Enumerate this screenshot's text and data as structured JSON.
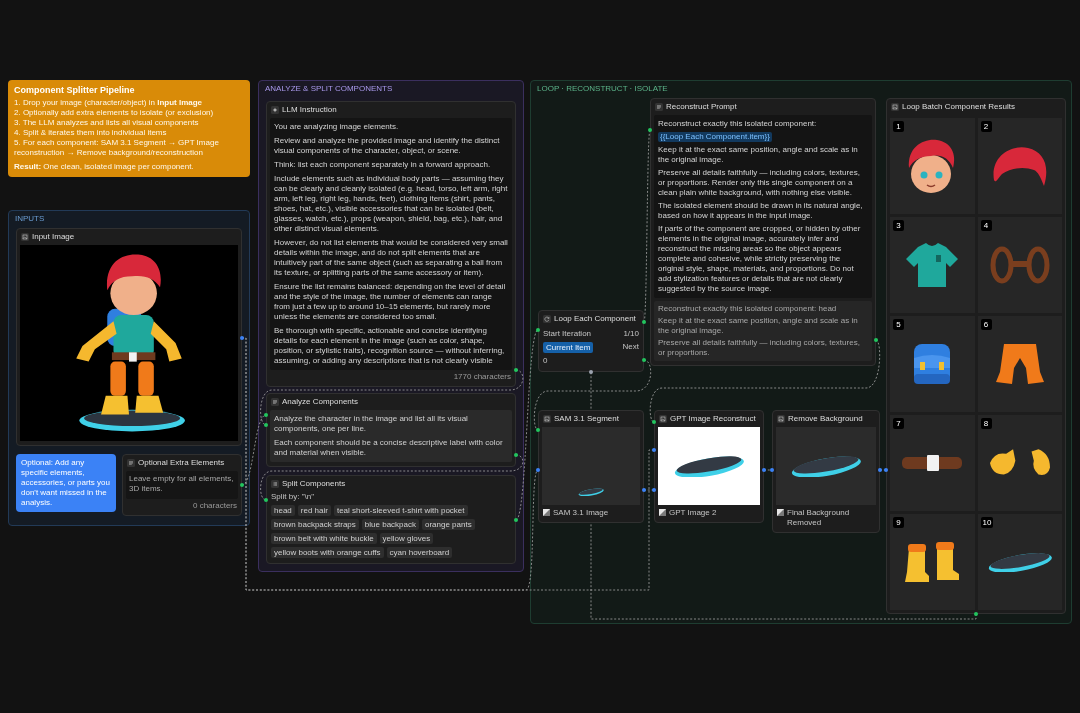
{
  "pipeline_note": {
    "title": "Component Splitter Pipeline",
    "steps": [
      "1. Drop your image (character/object) in **Input Image**",
      "2. Optionally add extra elements to isolate (or exclusion)",
      "3. The LLM analyzes and lists all visual components",
      "4. Split & iterates them into individual items",
      "5. For each component: SAM 3.1 Segment → GPT Image reconstruction → Remove background/reconstruction"
    ],
    "result": "**Result:** One clean, isolated image per component."
  },
  "inputs_group": {
    "title": "INPUTS",
    "input_image": {
      "title": "Input Image"
    },
    "hint": "Optional: Add any specific elements, accessories, or parts you don't want missed in the analysis.",
    "extra_elements": {
      "title": "Optional Extra Elements",
      "placeholder": "Leave empty for all elements, 3D items.",
      "counter": "0 characters"
    }
  },
  "analyze_group": {
    "title": "ANALYZE & SPLIT COMPONENTS",
    "llm_instruction": {
      "title": "LLM Instruction",
      "paragraphs": [
        "You are analyzing image elements.",
        "Review and analyze the provided image and identify the distinct visual components of the character, object, or scene.",
        "Think: list each component separately in a forward approach.",
        "Include elements such as individual body parts — assuming they can be clearly and cleanly isolated (e.g. head, torso, left arm, right arm, left leg, right leg, hands, feet), clothing items (shirt, pants, shoes, hat, etc.), visible accessories that can be isolated (belt, glasses, watch, etc.), props (weapon, shield, bag, etc.), hair, and other distinct visual elements.",
        "However, do not list elements that would be considered very small details within the image, and do not split elements that are intuitively part of the same object (such as separating a ball from its texture, or splitting parts of the same accessory or item).",
        "Ensure the list remains balanced: depending on the level of detail and the style of the image, the number of elements can range from just a few up to around 10–15 elements, but rarely more unless the elements are considered too small.",
        "Be thorough with specific, actionable and concise identifying details for each element in the image (such as color, shape, position, or stylistic traits), recognition source — without inferring, assuming, or adding any descriptions that is not clearly visible"
      ],
      "counter": "1770 characters"
    },
    "analyze_components": {
      "title": "Analyze Components",
      "paragraphs": [
        "Analyze the character in the image and list all its visual components, one per line.",
        "Each component should be a concise descriptive label with color and material when visible."
      ]
    },
    "split_components": {
      "title": "Split Components",
      "split_by": "Split by: \"\\n\"",
      "items": [
        "head",
        "red hair",
        "teal short-sleeved t-shirt with pocket",
        "brown backpack straps",
        "blue backpack",
        "orange pants",
        "brown belt with white buckle",
        "yellow gloves",
        "yellow boots with orange cuffs",
        "cyan hoverboard"
      ]
    }
  },
  "loop_group": {
    "title": "LOOP · RECONSTRUCT · ISOLATE",
    "reconstruct_prompt": {
      "title": "Reconstruct Prompt",
      "intro": "Reconstruct exactly this isolated component:",
      "variable": "{{Loop Each Component.item}}",
      "paragraphs": [
        "Keep it at the exact same position, angle and scale as in the original image.",
        "Preserve all details faithfully — including colors, textures, or proportions. Render only this single component on a clean plain white background, with nothing else visible.",
        "The isolated element should be drawn in its natural angle, based on how it appears in the input image.",
        "If parts of the component are cropped, or hidden by other elements in the original image, accurately infer and reconstruct the missing areas so the object appears complete and cohesive, while strictly preserving the original style, shape, materials, and proportions. Do not add stylization features or details that are not clearly suggested by the source image."
      ],
      "previews": [
        "Reconstruct exactly this isolated component: head",
        "Keep it at the exact same position, angle and scale as in the original image.",
        "Preserve all details faithfully — including colors, textures, or proportions."
      ]
    },
    "loop_each": {
      "title": "Loop Each Component",
      "start_label": "Start Iteration",
      "start_value": "1/10",
      "current": "Current Item",
      "next": "Next",
      "index": "0"
    },
    "sam_segment": {
      "title": "SAM 3.1 Segment",
      "footer": "SAM 3.1 Image"
    },
    "gpt_reconstruct": {
      "title": "GPT Image Reconstruct",
      "footer": "GPT Image 2"
    },
    "remove_background": {
      "title": "Remove Background",
      "footer": "Final Background Removed"
    },
    "results": {
      "title": "Loop Batch Component Results",
      "items": [
        {
          "number": "1",
          "kind": "head"
        },
        {
          "number": "2",
          "kind": "hair"
        },
        {
          "number": "3",
          "kind": "shirt"
        },
        {
          "number": "4",
          "kind": "straps"
        },
        {
          "number": "5",
          "kind": "backpack"
        },
        {
          "number": "6",
          "kind": "pants"
        },
        {
          "number": "7",
          "kind": "belt"
        },
        {
          "number": "8",
          "kind": "gloves"
        },
        {
          "number": "9",
          "kind": "boots"
        },
        {
          "number": "10",
          "kind": "board"
        }
      ]
    }
  }
}
